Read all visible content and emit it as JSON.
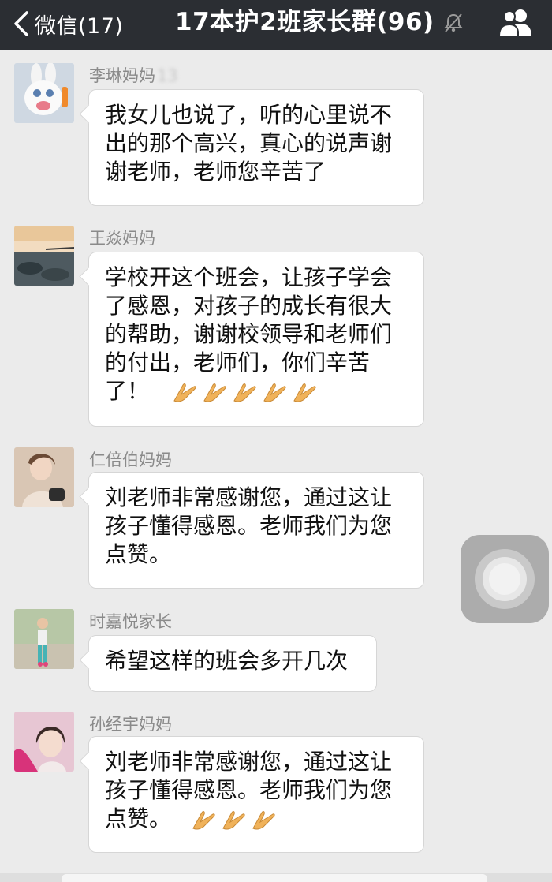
{
  "navbar": {
    "back_label": "微信(17)",
    "title": "17本护2班家长群(96)",
    "icons": {
      "back": "chevron-left-icon",
      "mute": "mute-bell-icon",
      "group": "group-members-icon"
    }
  },
  "messages": [
    {
      "sender": "李琳妈妈",
      "sender_obscured": "13",
      "text": "我女儿也说了，听的心里说不出的那个高兴，真心的说声谢谢老师，老师您辛苦了",
      "emoji_count": 0
    },
    {
      "sender": "王焱妈妈",
      "text": "学校开这个班会，让孩子学会了感恩，对孩子的成长有很大的帮助，谢谢校领导和老师们的付出，老师们，你们辛苦了！",
      "emoji_count": 5
    },
    {
      "sender": "仁倍伯妈妈",
      "text": "刘老师非常感谢您，通过这让孩子懂得感恩。老师我们为您点赞。",
      "emoji_count": 0
    },
    {
      "sender": "时嘉悦家长",
      "text": "希望这样的班会多开几次",
      "emoji_count": 0
    },
    {
      "sender": "孙经宇妈妈",
      "text": "刘老师非常感谢您，通过这让孩子懂得感恩。老师我们为您点赞。",
      "emoji_count": 3
    }
  ],
  "emoji": "praying-hands-icon",
  "colors": {
    "navbar_bg": "#2b2e33",
    "chat_bg": "#ebebeb",
    "bubble_bg": "#ffffff",
    "sender_text": "#8a8a8a"
  }
}
